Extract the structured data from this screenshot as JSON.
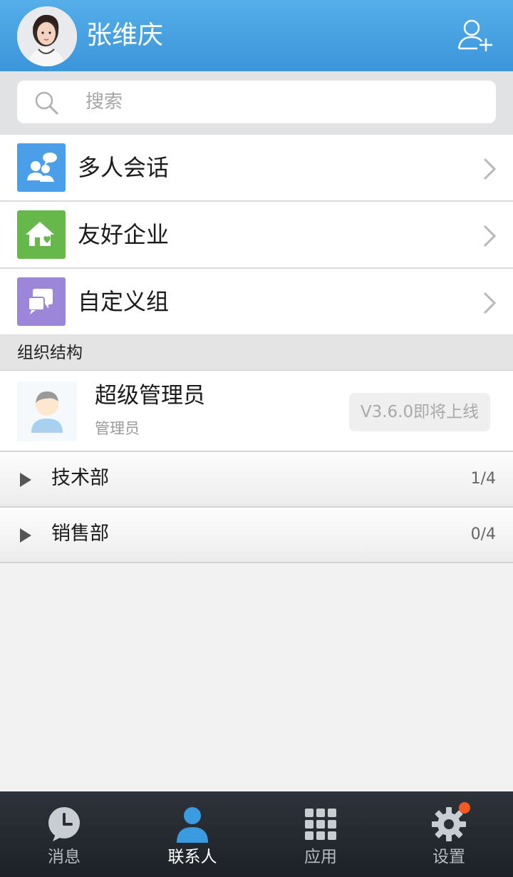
{
  "header": {
    "user_name": "张维庆",
    "avatar_icon": "user-photo-avatar",
    "add_icon": "add-contact-icon"
  },
  "search": {
    "placeholder": "搜索"
  },
  "menu": [
    {
      "label": "多人会话",
      "icon": "group-chat-icon",
      "color": "#4a9fe8"
    },
    {
      "label": "友好企业",
      "icon": "home-heart-icon",
      "color": "#66b84a"
    },
    {
      "label": "自定义组",
      "icon": "chat-bubbles-icon",
      "color": "#9b86d9"
    }
  ],
  "org": {
    "section_title": "组织结构",
    "admin": {
      "name": "超级管理员",
      "role": "管理员",
      "badge": "V3.6.0即将上线"
    },
    "departments": [
      {
        "name": "技术部",
        "count": "1/4"
      },
      {
        "name": "销售部",
        "count": "0/4"
      }
    ]
  },
  "nav": {
    "items": [
      {
        "label": "消息",
        "icon": "clock-bubble-icon",
        "active": false
      },
      {
        "label": "联系人",
        "icon": "person-icon",
        "active": true
      },
      {
        "label": "应用",
        "icon": "grid-icon",
        "active": false
      },
      {
        "label": "设置",
        "icon": "gear-icon",
        "active": false
      }
    ],
    "active_color": "#3b9be0",
    "badge_color": "#f25a22"
  }
}
